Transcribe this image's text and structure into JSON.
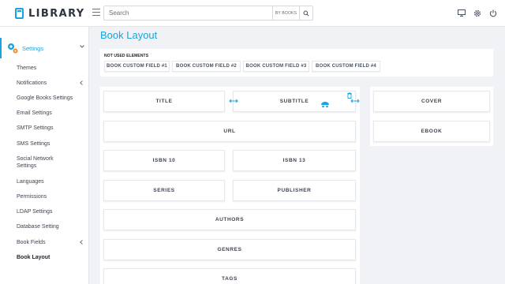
{
  "app": {
    "logo_text": "LIBRARY"
  },
  "header": {
    "search_placeholder": "Search",
    "search_scope": "BY BOOKS",
    "icons": [
      "monitor-icon",
      "gear-icon",
      "power-icon"
    ]
  },
  "sidebar": {
    "active": {
      "label": "Settings"
    },
    "items": [
      {
        "label": "Themes"
      },
      {
        "label": "Notifications"
      },
      {
        "label": "Google Books Settings"
      },
      {
        "label": "Email Settings"
      },
      {
        "label": "SMTP Settings"
      },
      {
        "label": "SMS Settings"
      },
      {
        "label": "Social Network"
      },
      {
        "label": "Settings"
      },
      {
        "label": "Languages"
      },
      {
        "label": "Permissions"
      },
      {
        "label": "LDAP Settings"
      },
      {
        "label": "Database Setting"
      },
      {
        "label": "Book Fields"
      },
      {
        "label": "Book Layout"
      }
    ]
  },
  "main": {
    "title": "Book Layout",
    "unused": {
      "title": "NOT USED ELEMENTS",
      "chips": [
        "BOOK CUSTOM FIELD #1",
        "BOOK CUSTOM FIELD #2",
        "BOOK CUSTOM FIELD #3",
        "BOOK CUSTOM FIELD #4"
      ]
    },
    "fields": {
      "title": "TITLE",
      "subtitle": "SUBTITLE",
      "url": "URL",
      "isbn10": "ISBN 10",
      "isbn13": "ISBN 13",
      "series": "SERIES",
      "publisher": "PUBLISHER",
      "authors": "AUTHORS",
      "genres": "GENRES",
      "tags": "TAGS",
      "cover": "COVER",
      "ebook": "EBOOK"
    }
  },
  "colors": {
    "accent": "#1aa3de"
  }
}
